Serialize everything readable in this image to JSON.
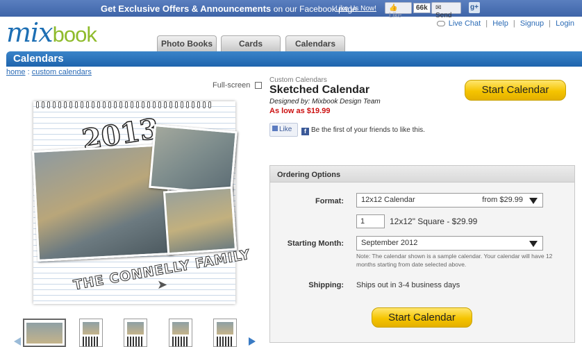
{
  "fb_bar": {
    "promo_bold": "Get Exclusive Offers & Announcements",
    "promo_suffix": "on our Facebook page",
    "like_us": "Like Us Now!",
    "like_button": "Like",
    "like_count": "66k",
    "send_button": "Send",
    "gplus_icon": "google-plus-icon"
  },
  "header": {
    "logo_mix": "mix",
    "logo_book": "book",
    "links": {
      "live_chat": "Live Chat",
      "help": "Help",
      "signup": "Signup",
      "login": "Login"
    },
    "tabs": [
      "Photo Books",
      "Cards",
      "Calendars"
    ]
  },
  "section": {
    "title": "Calendars"
  },
  "breadcrumb": {
    "home": "home",
    "separator": ":",
    "current": "custom calendars"
  },
  "preview": {
    "fullscreen_label": "Full-screen",
    "year_text": "2013",
    "family_text": "THE CONNELLY FAMILY"
  },
  "product": {
    "category": "Custom Calendars",
    "title": "Sketched Calendar",
    "designer": "Designed by: Mixbook Design Team",
    "price": "As low as $19.99",
    "start_button": "Start Calendar"
  },
  "facebook": {
    "like_button": "Like",
    "like_text": "Be the first of your friends to like this."
  },
  "ordering": {
    "header": "Ordering Options",
    "format_label": "Format:",
    "format_value": "12x12 Calendar",
    "format_price": "from $29.99",
    "quantity": "1",
    "quantity_desc": "12x12\" Square - $29.99",
    "month_label": "Starting Month:",
    "month_value": "September 2012",
    "note": "Note: The calendar shown is a sample calendar. Your calendar will have 12 months starting from date selected above.",
    "shipping_label": "Shipping:",
    "shipping_value": "Ships out in 3-4 business days",
    "start_button": "Start Calendar"
  },
  "colors": {
    "accent_blue": "#1e64ad",
    "facebook_blue": "#3e64a8",
    "price_red": "#cc1010",
    "button_yellow": "#f5c400"
  }
}
